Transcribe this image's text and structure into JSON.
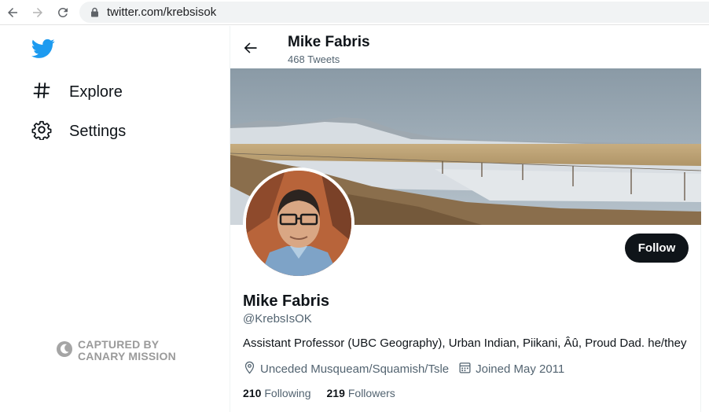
{
  "browser": {
    "url": "twitter.com/krebsisok",
    "icons": [
      "back-arrow-icon",
      "forward-arrow-icon",
      "reload-icon",
      "lock-icon"
    ]
  },
  "sidebar": {
    "logo_icon": "twitter-bird-icon",
    "items": [
      {
        "label": "Explore",
        "icon": "hashtag-icon"
      },
      {
        "label": "Settings",
        "icon": "gear-icon"
      }
    ],
    "watermark": {
      "line1": "CAPTURED BY",
      "line2": "CANARY MISSION"
    }
  },
  "header": {
    "name": "Mike Fabris",
    "tweet_count": "468 Tweets"
  },
  "profile": {
    "name": "Mike Fabris",
    "handle": "@KrebsIsOK",
    "bio": "Assistant Professor (UBC Geography), Urban Indian, Piikani, Âû, Proud Dad. he/they",
    "location": "Unceded Musqueam/Squamish/Tsle",
    "joined": "Joined May 2011",
    "following_count": "210",
    "following_label": "Following",
    "followers_count": "219",
    "followers_label": "Followers",
    "follow_button": "Follow"
  },
  "colors": {
    "text_primary": "#0f1419",
    "text_secondary": "#536471",
    "twitter_blue": "#1d9bf0",
    "button_dark": "#0f1419"
  }
}
